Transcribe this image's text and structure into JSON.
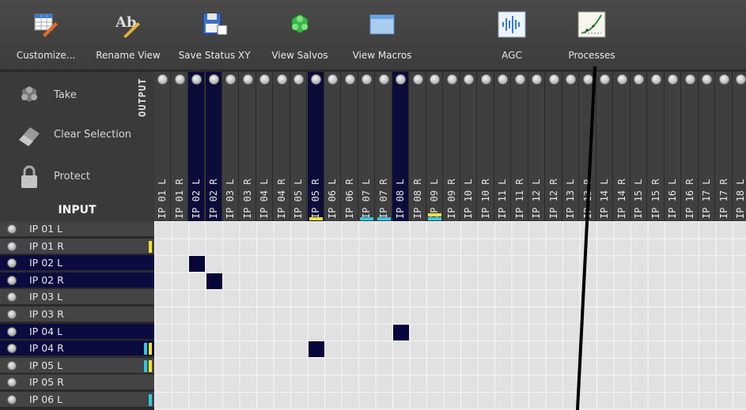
{
  "toolbar": {
    "buttons": [
      {
        "label": "Customize...",
        "icon": "customize-icon"
      },
      {
        "label": "Rename View",
        "icon": "rename-icon"
      },
      {
        "label": "Save Status XY",
        "icon": "save-icon"
      },
      {
        "label": "View Salvos",
        "icon": "salvos-icon"
      },
      {
        "label": "View Macros",
        "icon": "macros-icon"
      },
      {
        "label": "AGC",
        "icon": "agc-icon"
      },
      {
        "label": "Processes",
        "icon": "processes-icon"
      }
    ]
  },
  "left_panel": {
    "take_label": "Take",
    "clear_label": "Clear Selection",
    "protect_label": "Protect",
    "output_title": "OUTPUT",
    "input_title": "INPUT"
  },
  "outputs": [
    {
      "label": "IP 01 L"
    },
    {
      "label": "IP 01 R"
    },
    {
      "label": "IP 02 L",
      "selected": true
    },
    {
      "label": "IP 02 R",
      "selected": true
    },
    {
      "label": "IP 03 L"
    },
    {
      "label": "IP 03 R"
    },
    {
      "label": "IP 04 L"
    },
    {
      "label": "IP 04 R"
    },
    {
      "label": "IP 05 L"
    },
    {
      "label": "IP 05 R",
      "selected": true,
      "indicator": "#f2e234"
    },
    {
      "label": "IP 06 L"
    },
    {
      "label": "IP 06 R"
    },
    {
      "label": "IP 07 L",
      "indicator": "#35c6e0"
    },
    {
      "label": "IP 07 R",
      "indicator": "#35c6e0"
    },
    {
      "label": "IP 08 L",
      "selected": true
    },
    {
      "label": "IP 08 R"
    },
    {
      "label": "IP 09 L",
      "indicator": "#f2e234",
      "indicator2": "#35c6e0"
    },
    {
      "label": "IP 09 R"
    },
    {
      "label": "IP 10 L"
    },
    {
      "label": "IP 10 R"
    },
    {
      "label": "IP 11 L"
    },
    {
      "label": "IP 11 R"
    },
    {
      "label": "IP 12 L"
    },
    {
      "label": "IP 12 R"
    },
    {
      "label": "IP 13 L"
    },
    {
      "label": "IP 13 R"
    },
    {
      "label": "IP 14 L"
    },
    {
      "label": "IP 14 R"
    },
    {
      "label": "IP 15 L"
    },
    {
      "label": "IP 15 R"
    },
    {
      "label": "IP 16 L"
    },
    {
      "label": "IP 16 R"
    },
    {
      "label": "IP 17 L"
    },
    {
      "label": "IP 17 R"
    },
    {
      "label": "IP 18 L"
    }
  ],
  "inputs": [
    {
      "label": "IP 01 L"
    },
    {
      "label": "IP 01 R",
      "indicators": [
        "#f2e234"
      ]
    },
    {
      "label": "IP 02 L",
      "selected": true
    },
    {
      "label": "IP 02 R",
      "selected": true
    },
    {
      "label": "IP 03 L"
    },
    {
      "label": "IP 03 R"
    },
    {
      "label": "IP 04 L",
      "selected": true
    },
    {
      "label": "IP 04 R",
      "selected": true,
      "indicators": [
        "#35c6e0",
        "#f2e234"
      ]
    },
    {
      "label": "IP 05 L",
      "indicators": [
        "#35c6e0",
        "#f2e234"
      ]
    },
    {
      "label": "IP 05 R"
    },
    {
      "label": "IP 06 L",
      "indicators": [
        "#35c6e0"
      ]
    }
  ],
  "crosspoints": [
    {
      "input": 2,
      "output": 2
    },
    {
      "input": 3,
      "output": 3
    },
    {
      "input": 6,
      "output": 14
    },
    {
      "input": 7,
      "output": 9
    }
  ],
  "colors": {
    "selected": "#0b0b40",
    "crosspoint": "#06063a",
    "yellow_indicator": "#f2e234",
    "cyan_indicator": "#35c6e0"
  }
}
